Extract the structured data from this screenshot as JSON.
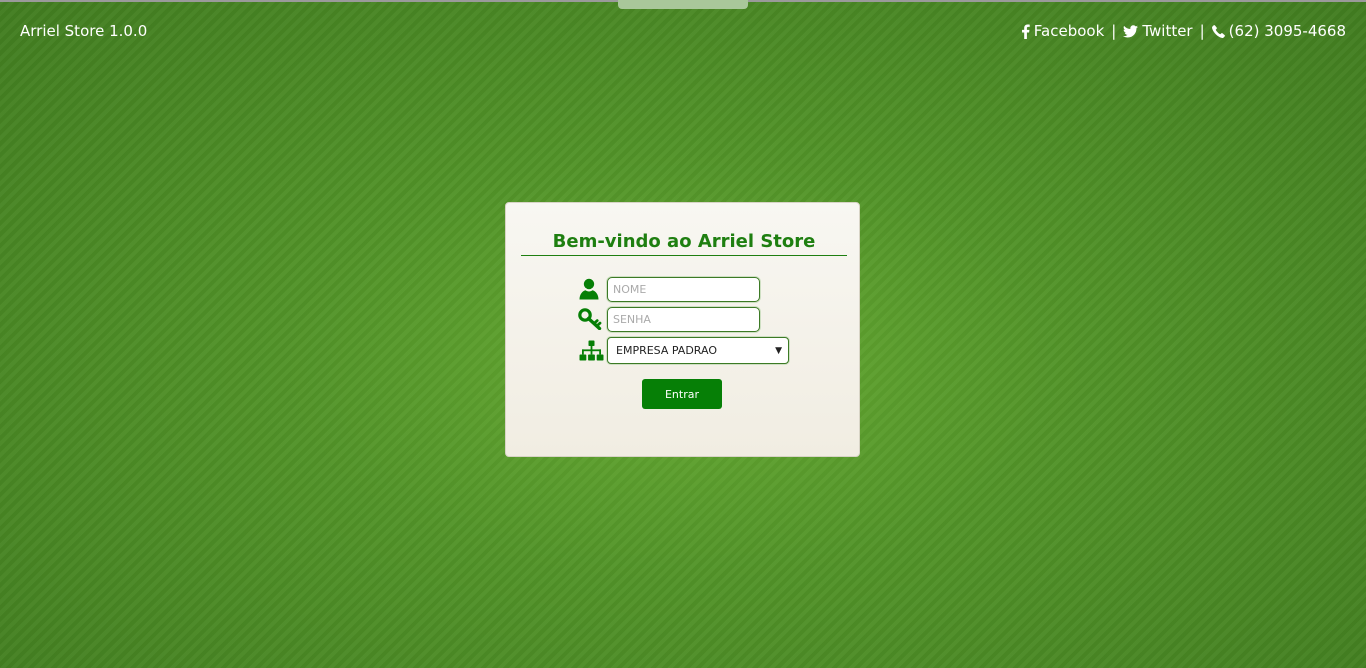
{
  "header": {
    "brand": "Arriel Store 1.0.0",
    "links": [
      {
        "icon": "facebook-icon",
        "label": "Facebook"
      },
      {
        "icon": "twitter-icon",
        "label": "Twitter"
      },
      {
        "icon": "phone-icon",
        "label": "(62) 3095-4668"
      }
    ],
    "separator": "|"
  },
  "login": {
    "title": "Bem-vindo ao Arriel Store",
    "user_placeholder": "NOME",
    "password_placeholder": "SENHA",
    "company_selected": "EMPRESA PADRAO",
    "company_arrow": "▼",
    "submit_label": "Entrar"
  },
  "colors": {
    "accent": "#1e7f10",
    "button": "#067f06",
    "background": "#4f8f27"
  }
}
